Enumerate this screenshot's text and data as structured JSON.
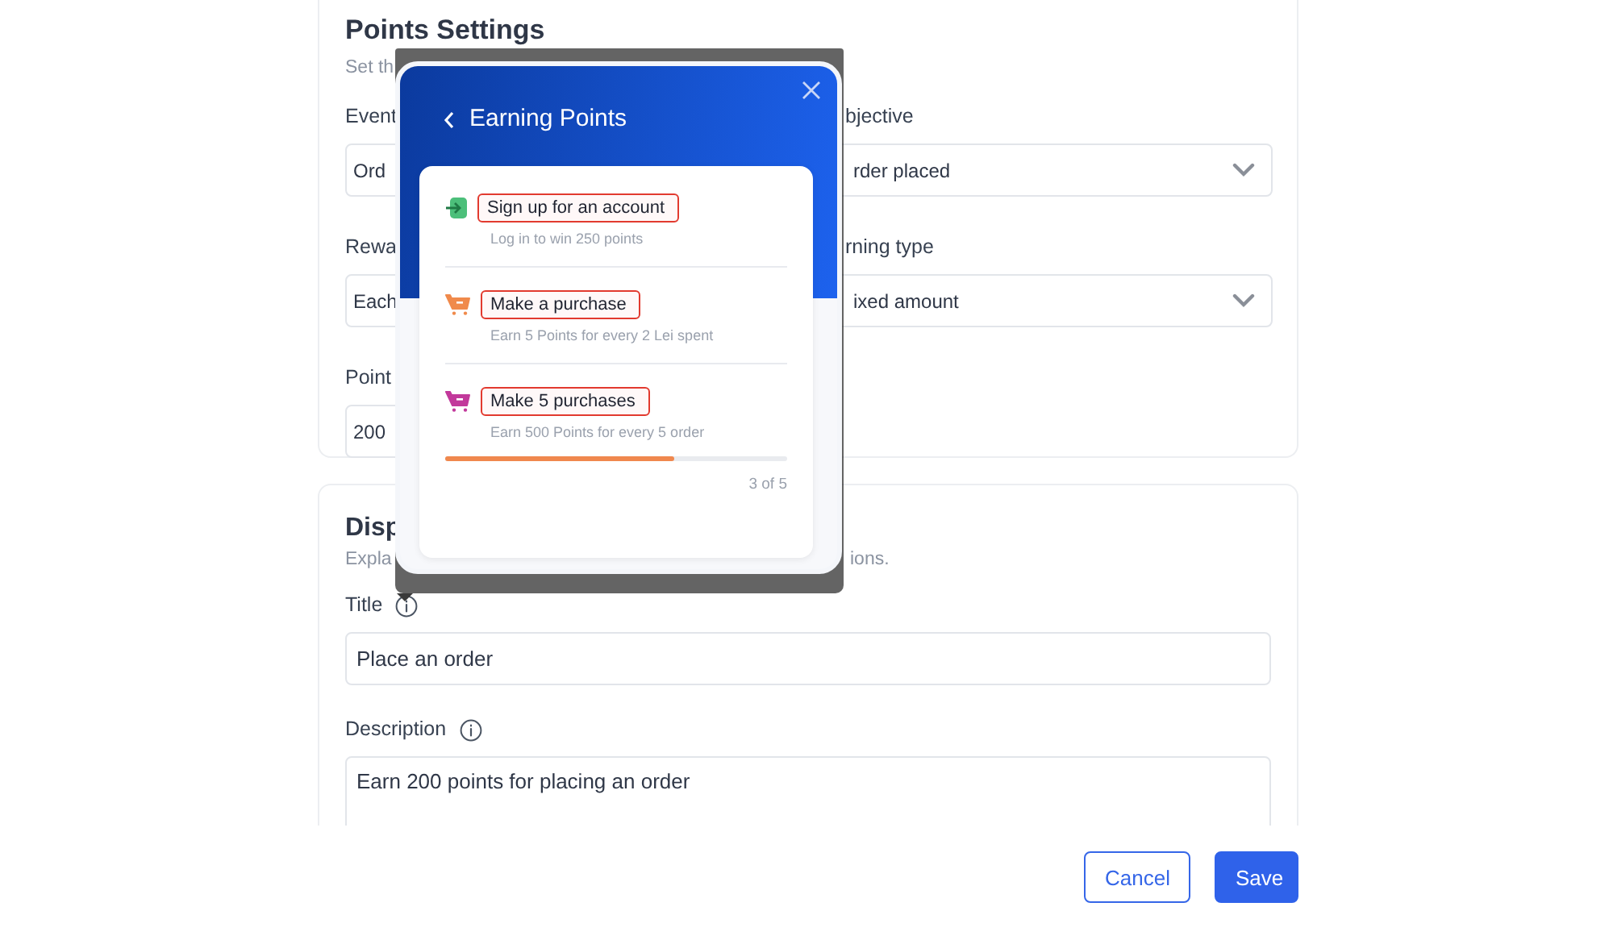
{
  "points_settings": {
    "title": "Points Settings",
    "subtitle": "Set th",
    "fields_left": [
      {
        "label": "Event",
        "value": "Ord",
        "kind": "text"
      },
      {
        "label": "Rewa",
        "value": "Each",
        "kind": "text"
      },
      {
        "label": "Point",
        "value": "200",
        "kind": "text"
      }
    ],
    "fields_right": [
      {
        "label": "bjective",
        "value": "rder placed",
        "kind": "select"
      },
      {
        "label": "rning type",
        "value": "ixed amount",
        "kind": "select"
      }
    ]
  },
  "display_settings": {
    "title": "Disp",
    "subtitle_start": "Expla",
    "subtitle_end": "ions.",
    "fields": [
      {
        "label": "Title",
        "value": "Place an order",
        "kind": "input"
      },
      {
        "label": "Description",
        "value": "Earn 200 points for placing an order",
        "kind": "textarea"
      }
    ]
  },
  "popup": {
    "title": "Earning Points",
    "items": [
      {
        "title": "Sign up for an account",
        "detail": "Log in to win 250 points",
        "kind": "signup",
        "color": "#4cbf7a"
      },
      {
        "title": "Make a purchase",
        "detail": "Earn 5 Points for every 2 Lei spent",
        "kind": "cart",
        "color": "#f08a4b"
      },
      {
        "title": "Make 5 purchases",
        "detail": "Earn 500 Points for every 5 order",
        "kind": "cart",
        "color": "#c2399b",
        "progress": {
          "level": 0.67,
          "reading": "3 of 5"
        }
      }
    ]
  },
  "buttons": [
    {
      "label": "Cancel",
      "kind": "secondary"
    },
    {
      "label": "Save",
      "kind": "primary"
    }
  ]
}
